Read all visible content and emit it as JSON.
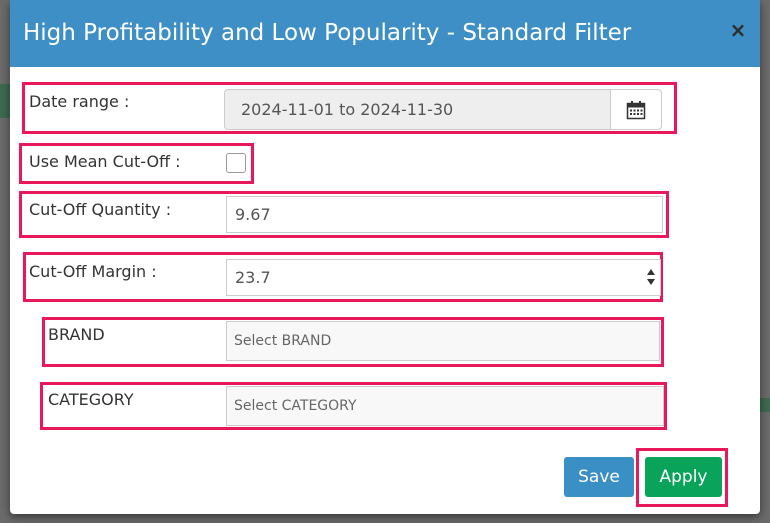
{
  "modal": {
    "title": "High Profitability and Low Popularity - Standard Filter",
    "close_label": "×"
  },
  "form": {
    "date_range": {
      "label": "Date range :",
      "value": "2024-11-01 to 2024-11-30"
    },
    "use_mean_cutoff": {
      "label": "Use Mean Cut-Off :",
      "checked": false
    },
    "cutoff_quantity": {
      "label": "Cut-Off Quantity :",
      "value": "9.67"
    },
    "cutoff_margin": {
      "label": "Cut-Off Margin :",
      "value": "23.7"
    },
    "brand": {
      "label": "BRAND",
      "placeholder": "Select BRAND"
    },
    "category": {
      "label": "CATEGORY",
      "placeholder": "Select CATEGORY"
    }
  },
  "buttons": {
    "save_label": "Save",
    "apply_label": "Apply"
  },
  "colors": {
    "header": "#3d8fc6",
    "highlight": "#e8185a",
    "save": "#3a8fc4",
    "apply": "#0aa35a"
  },
  "icons": [
    "calendar-icon",
    "close-icon",
    "spinner-icon"
  ]
}
